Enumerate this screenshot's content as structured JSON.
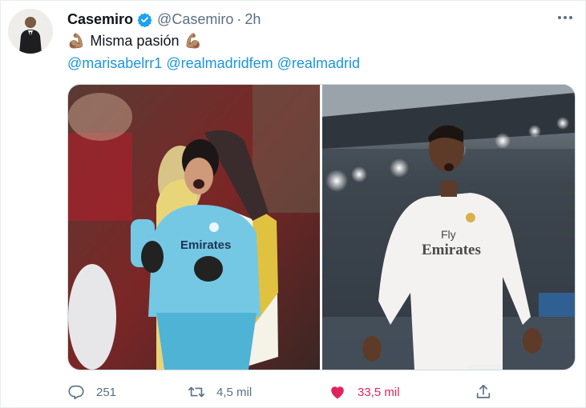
{
  "tweet": {
    "author_name": "Casemiro",
    "author_handle": "@Casemiro",
    "separator": "·",
    "time": "2h",
    "text": "Misma pasión",
    "emoji_left": "💪🏽",
    "emoji_right": "💪🏽",
    "mentions": [
      "@marisabelrr1",
      "@realmadridfem",
      "@realmadrid"
    ],
    "photo_left_text": "Emirates",
    "photo_right_text_1": "Fly",
    "photo_right_text_2": "Emirates"
  },
  "actions": {
    "reply_count": "251",
    "retweet_count": "4,5 mil",
    "like_count": "33,5 mil"
  },
  "colors": {
    "link": "#1b95e0",
    "verified": "#1da1f2",
    "like": "#e0245e",
    "muted": "#5b7083"
  },
  "icons": [
    "verified-badge-icon",
    "more-icon",
    "reply-icon",
    "retweet-icon",
    "like-icon",
    "share-icon"
  ]
}
